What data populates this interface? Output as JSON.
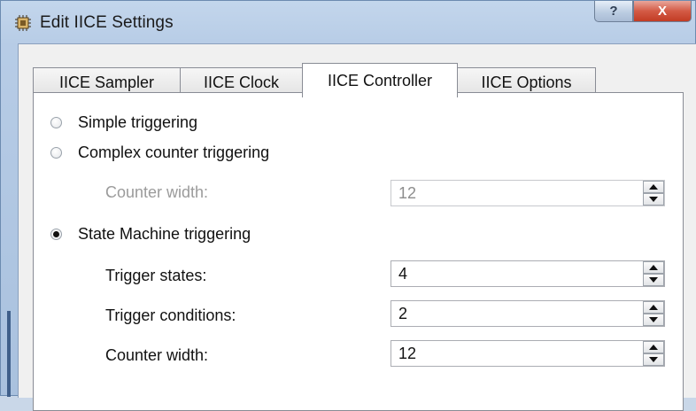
{
  "window": {
    "title": "Edit IICE Settings",
    "help_symbol": "?",
    "close_symbol": "X",
    "icon": "chip-gear-icon"
  },
  "tabs": [
    {
      "label": "IICE Sampler",
      "active": false
    },
    {
      "label": "IICE Clock",
      "active": false
    },
    {
      "label": "IICE Controller",
      "active": true
    },
    {
      "label": "IICE Options",
      "active": false
    }
  ],
  "controller": {
    "simple_label": "Simple triggering",
    "complex_label": "Complex counter triggering",
    "complex_counter_width_label": "Counter width:",
    "complex_counter_width_value": "12",
    "state_machine_label": "State Machine triggering",
    "trigger_states_label": "Trigger states:",
    "trigger_states_value": "4",
    "trigger_conditions_label": "Trigger conditions:",
    "trigger_conditions_value": "2",
    "counter_width_label": "Counter width:",
    "counter_width_value": "12",
    "selected": "state_machine"
  },
  "colors": {
    "titlebar": "#b9cde6",
    "close_button": "#c94a33",
    "panel_background": "#ffffff",
    "disabled_text": "#9b9b9b"
  }
}
